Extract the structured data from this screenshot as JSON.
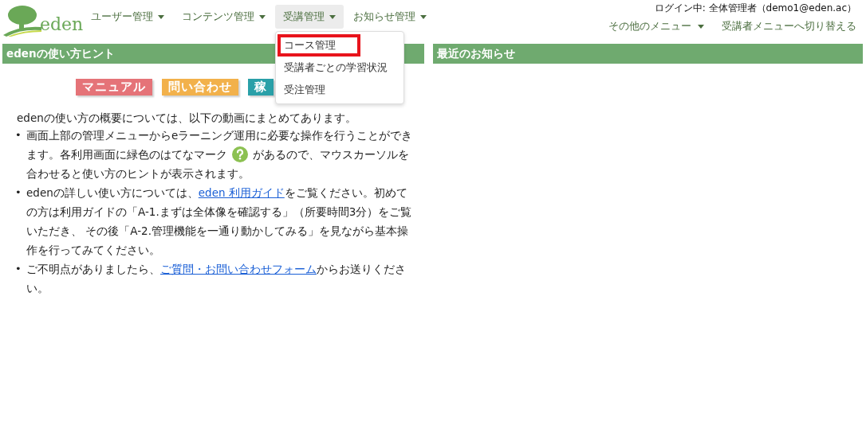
{
  "logo": {
    "text": "eden"
  },
  "nav": [
    {
      "label": "ユーザー管理",
      "open": false
    },
    {
      "label": "コンテンツ管理",
      "open": false
    },
    {
      "label": "受講管理",
      "open": true,
      "menu": [
        {
          "label": "コース管理",
          "highlighted": true
        },
        {
          "label": "受講者ごとの学習状況",
          "highlighted": false
        },
        {
          "label": "受注管理",
          "highlighted": false
        }
      ]
    },
    {
      "label": "お知らせ管理",
      "open": false
    }
  ],
  "login": "ログイン中: 全体管理者（demo1@eden.ac）",
  "top_links": [
    {
      "label": "その他のメニュー",
      "dropdown": true
    },
    {
      "label": "受講者メニューへ切り替える",
      "dropdown": false
    }
  ],
  "hint_panel": {
    "title": "edenの使い方ヒント",
    "buttons": [
      {
        "label": "マニュアル",
        "color": "#e57378"
      },
      {
        "label": "問い合わせ",
        "color": "#f2b14b"
      },
      {
        "label": "稼",
        "color": "#2aa0a8"
      }
    ],
    "intro": "edenの使い方の概要については、以下の動画にまとめてあります。",
    "items": [
      {
        "bullet": "•",
        "parts": [
          {
            "kind": "text",
            "text": "画面上部の管理メニューからeラーニング運用に必要な操作を行うことができます。各利用画面に緑色のはてなマーク"
          },
          {
            "kind": "hint_icon"
          },
          {
            "kind": "text",
            "text": "があるので、マウスカーソルを合わせると使い方のヒントが表示されます。"
          }
        ]
      },
      {
        "bullet": "•",
        "parts": [
          {
            "kind": "text",
            "text": "edenの詳しい使い方については、"
          },
          {
            "kind": "link",
            "text": "eden 利用ガイド"
          },
          {
            "kind": "text",
            "text": "をご覧ください。初めての方は利用ガイドの「A-1.まずは全体像を確認する」（所要時間3分）をご覧いただき、 その後「A-2.管理機能を一通り動かしてみる」を見ながら基本操作を行ってみてください。"
          }
        ]
      },
      {
        "bullet": "•",
        "parts": [
          {
            "kind": "text",
            "text": "ご不明点がありましたら、"
          },
          {
            "kind": "link",
            "text": "ご質問・お問い合わせフォーム"
          },
          {
            "kind": "text",
            "text": "からお送りください。"
          }
        ]
      }
    ]
  },
  "news_panel": {
    "title": "最近のお知らせ"
  }
}
